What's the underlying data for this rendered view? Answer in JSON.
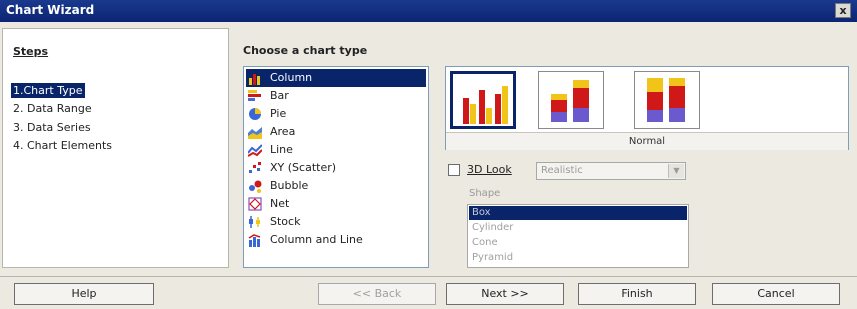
{
  "window": {
    "title": "Chart Wizard",
    "close_label": "x"
  },
  "steps": {
    "title": "Steps",
    "items": [
      {
        "label": "1.Chart Type"
      },
      {
        "label": "2. Data Range"
      },
      {
        "label": "3. Data Series"
      },
      {
        "label": "4. Chart Elements"
      }
    ]
  },
  "chart_types": {
    "title": "Choose a chart type",
    "items": [
      {
        "label": "Column",
        "icon": "column-chart-icon"
      },
      {
        "label": "Bar",
        "icon": "bar-chart-icon"
      },
      {
        "label": "Pie",
        "icon": "pie-chart-icon"
      },
      {
        "label": "Area",
        "icon": "area-chart-icon"
      },
      {
        "label": "Line",
        "icon": "line-chart-icon"
      },
      {
        "label": "XY (Scatter)",
        "icon": "scatter-chart-icon"
      },
      {
        "label": "Bubble",
        "icon": "bubble-chart-icon"
      },
      {
        "label": "Net",
        "icon": "net-chart-icon"
      },
      {
        "label": "Stock",
        "icon": "stock-chart-icon"
      },
      {
        "label": "Column and Line",
        "icon": "column-line-chart-icon"
      }
    ]
  },
  "variants": {
    "selected_label": "Normal"
  },
  "options": {
    "look_3d_label": "3D Look",
    "look_value": "Realistic",
    "shape_label": "Shape",
    "shapes": [
      "Box",
      "Cylinder",
      "Cone",
      "Pyramid"
    ]
  },
  "buttons": {
    "help": "Help",
    "back": "<< Back",
    "next": "Next >>",
    "finish": "Finish",
    "cancel": "Cancel"
  },
  "colors": {
    "selection": "#0a246a",
    "title_bar": "#0c2472",
    "bar_red": "#d01818",
    "bar_yellow": "#f0c419",
    "bar_purple": "#6a5acd"
  }
}
